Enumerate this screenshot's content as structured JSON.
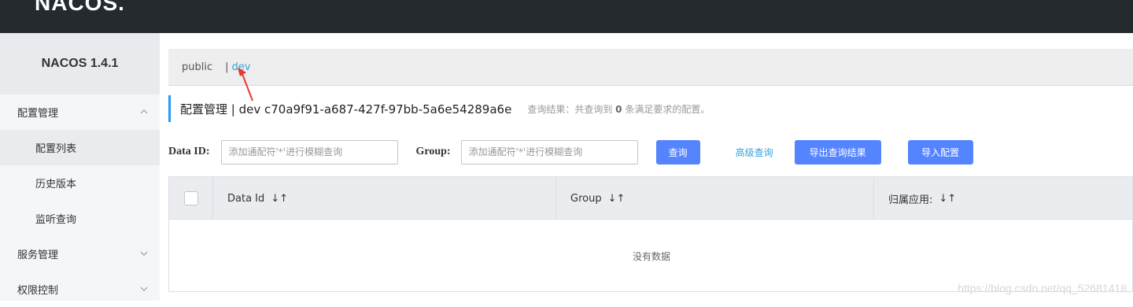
{
  "header": {
    "logo": "NACOS."
  },
  "sidebar": {
    "version": "NACOS 1.4.1",
    "groups": [
      {
        "label": "配置管理",
        "icon": "chevron-up-icon",
        "items": [
          {
            "label": "配置列表"
          },
          {
            "label": "历史版本"
          },
          {
            "label": "监听查询"
          }
        ]
      },
      {
        "label": "服务管理",
        "icon": "chevron-down-icon"
      },
      {
        "label": "权限控制",
        "icon": "chevron-down-icon"
      }
    ]
  },
  "namespaces": {
    "public": "public",
    "separator": "|",
    "dev": "dev"
  },
  "title": {
    "text": "配置管理  |  dev  c70a9f91-a687-427f-97bb-5a6e54289a6e",
    "hint_prefix": "查询结果：共查询到",
    "hint_count": "0",
    "hint_suffix": "条满足要求的配置。"
  },
  "search": {
    "data_id_label": "Data ID:",
    "data_id_placeholder": "添加通配符'*'进行模糊查询",
    "group_label": "Group:",
    "group_placeholder": "添加通配符'*'进行模糊查询",
    "query_button": "查询",
    "advanced_link": "高级查询",
    "export_button": "导出查询结果",
    "import_button": "导入配置"
  },
  "table": {
    "columns": [
      "Data Id",
      "Group",
      "归属应用:"
    ],
    "sort_icon": "↓↑",
    "empty_text": "没有数据"
  },
  "watermark": "https://blog.csdn.net/qq_52681418",
  "colors": {
    "topbar": "#252a2f",
    "accent": "#209bfa",
    "button": "#5584ff",
    "link": "#33a3dc"
  }
}
